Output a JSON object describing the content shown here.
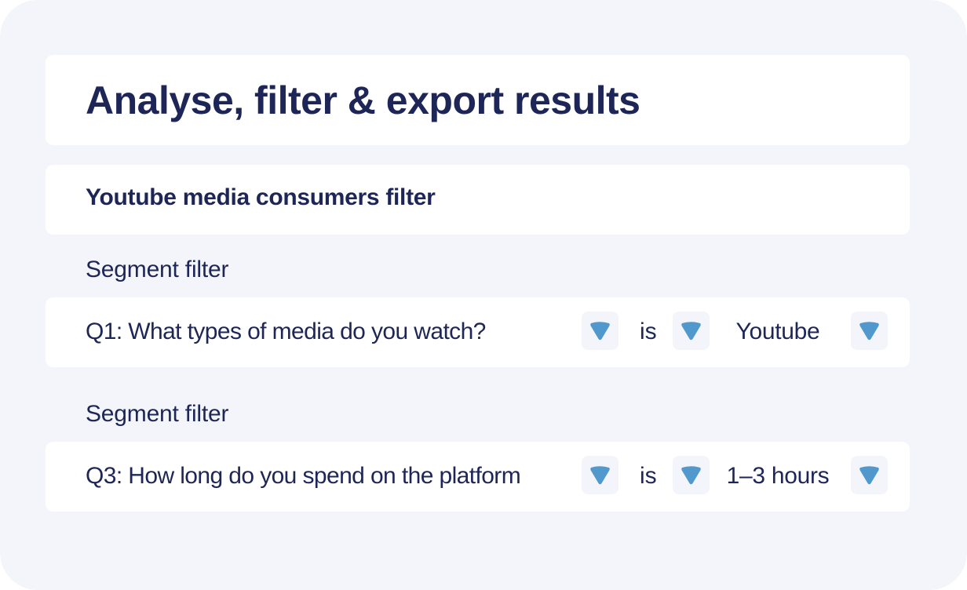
{
  "header": {
    "title": "Analyse, filter & export results"
  },
  "filter_group": {
    "name": "Youtube media consumers filter"
  },
  "segments": [
    {
      "section_label": "Segment filter",
      "question": "Q1: What types of media do you watch?",
      "operator": "is",
      "value": "Youtube"
    },
    {
      "section_label": "Segment filter",
      "question": "Q3: How long do you spend on the platform",
      "operator": "is",
      "value": "1–3 hours"
    }
  ],
  "icons": {
    "dropdown": "chevron-down-icon"
  },
  "colors": {
    "background": "#f4f5fa",
    "card": "#ffffff",
    "text": "#1d2657",
    "accent": "#5199cc"
  }
}
